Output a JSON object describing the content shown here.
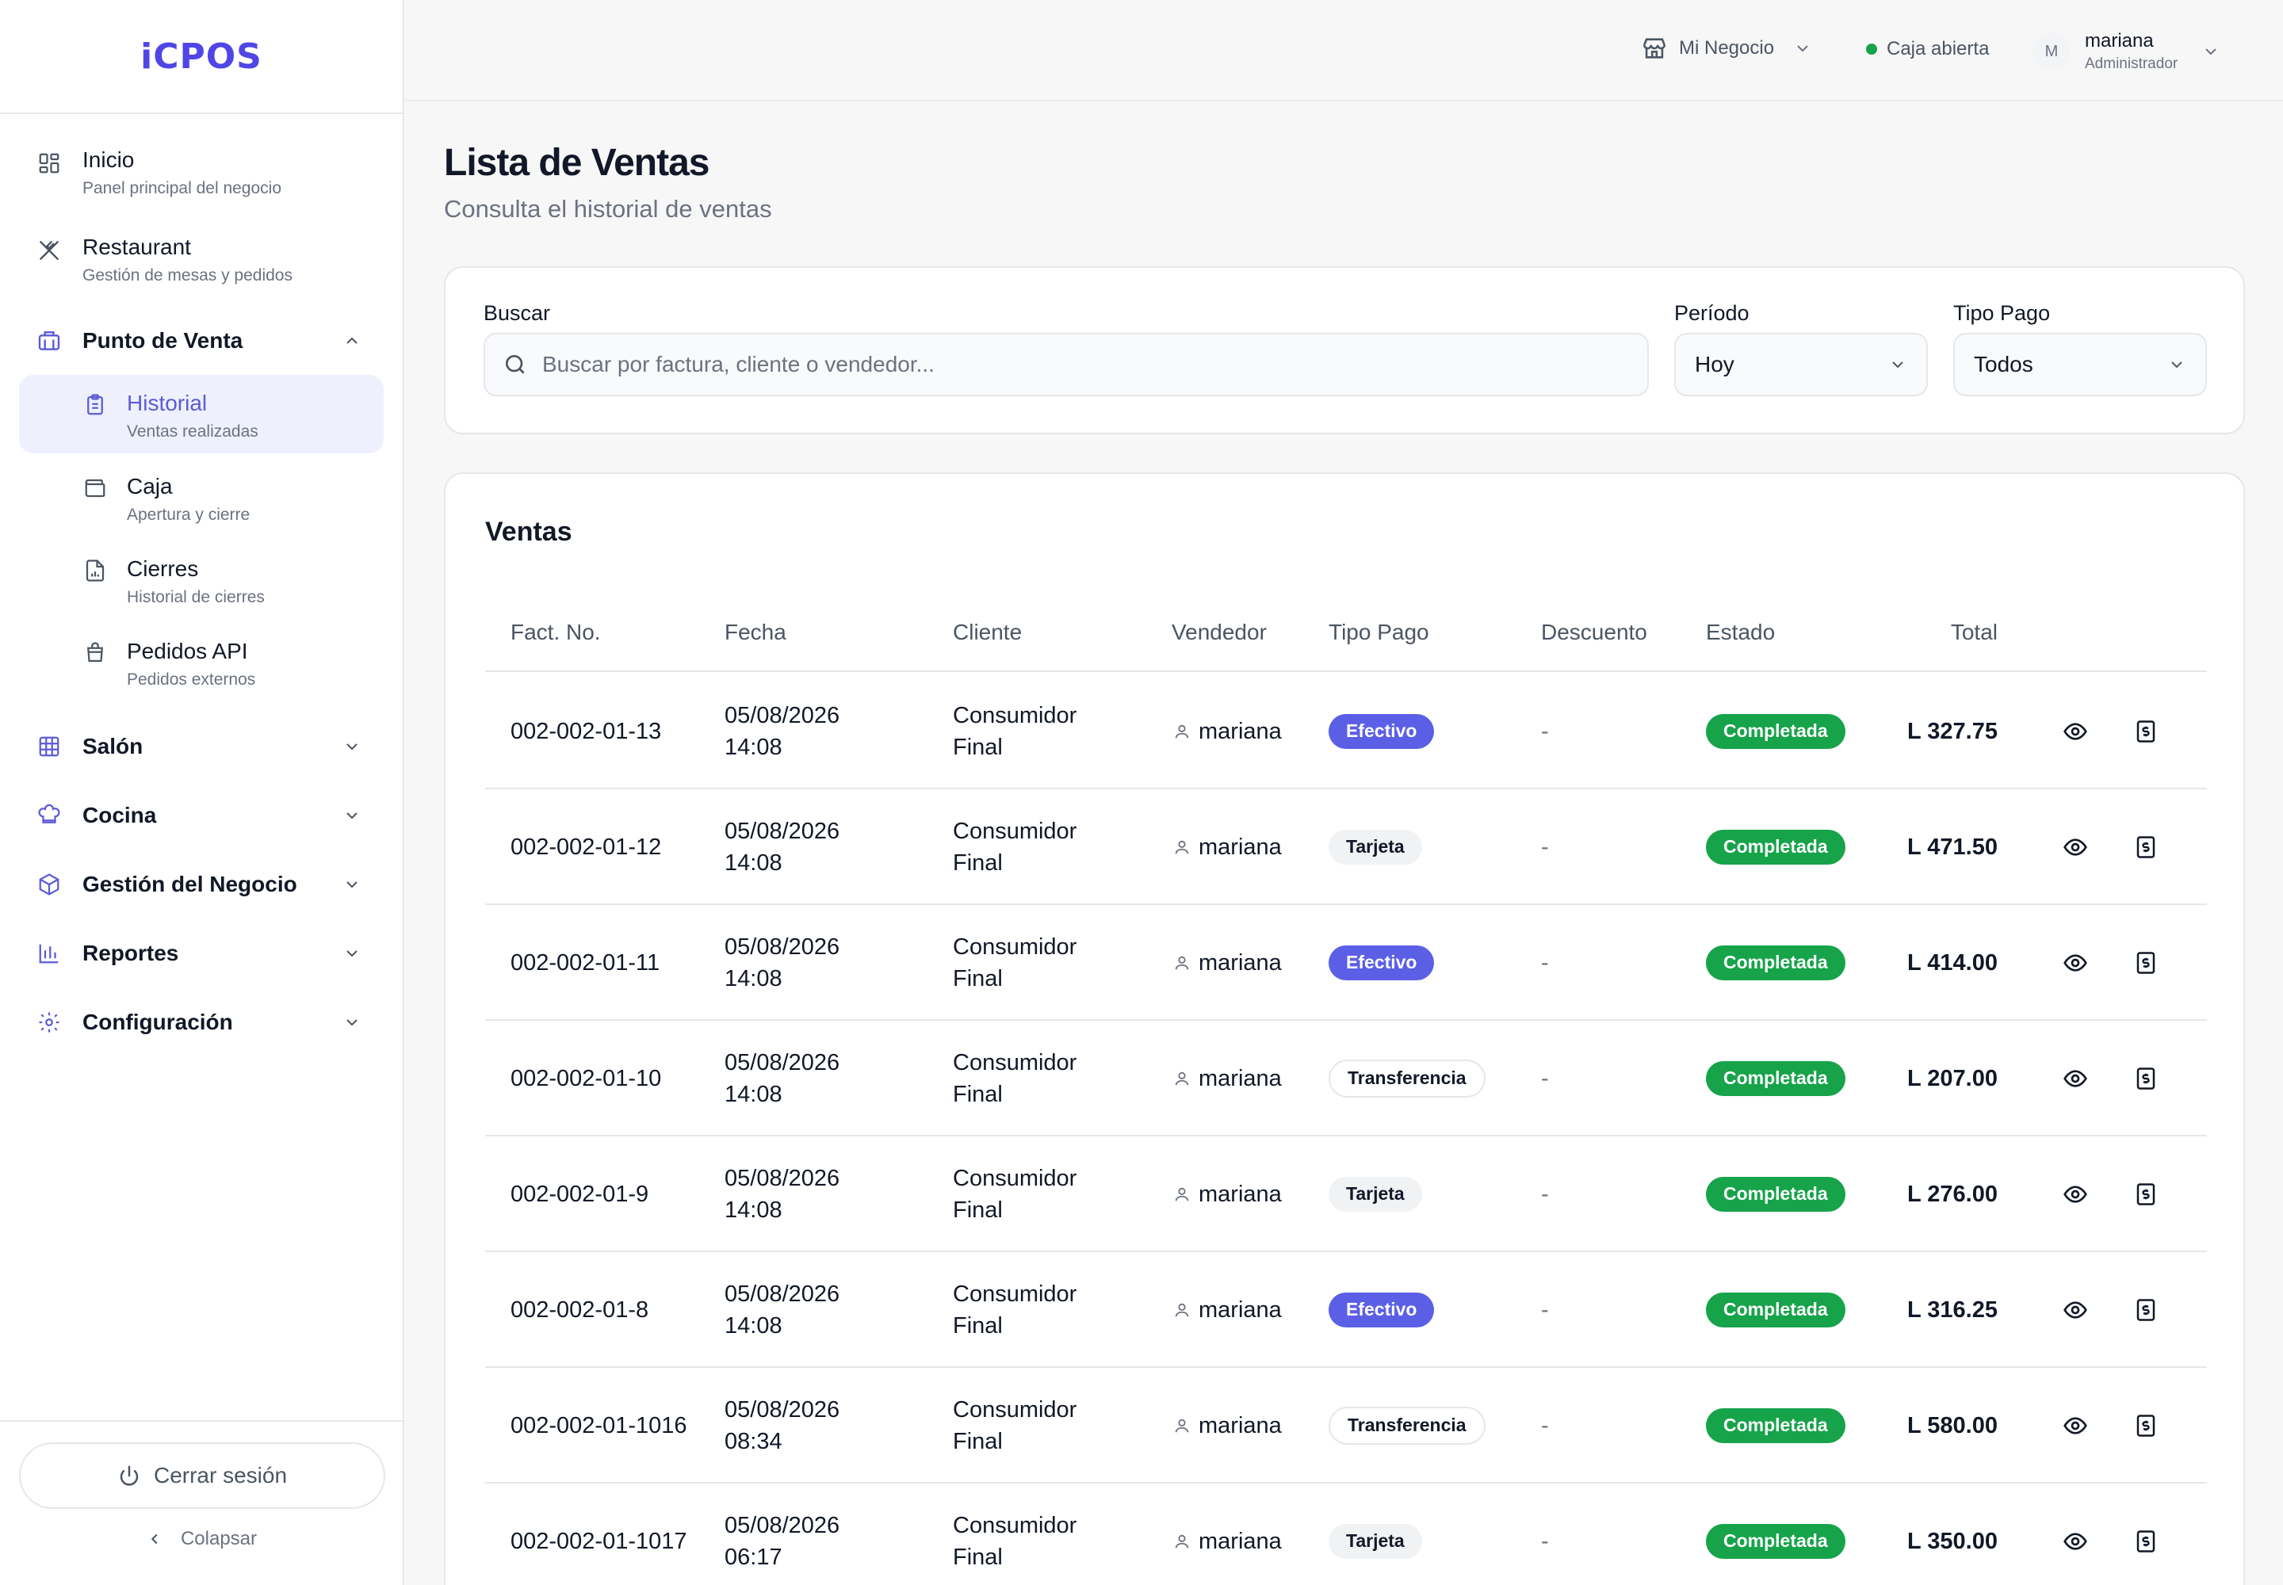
{
  "app": {
    "logo": "iCPOS"
  },
  "sidebar": {
    "inicio": {
      "label": "Inicio",
      "sub": "Panel principal del negocio"
    },
    "restaurant": {
      "label": "Restaurant",
      "sub": "Gestión de mesas y pedidos"
    },
    "punto_venta": {
      "label": "Punto de Venta"
    },
    "historial": {
      "label": "Historial",
      "sub": "Ventas realizadas"
    },
    "caja": {
      "label": "Caja",
      "sub": "Apertura y cierre"
    },
    "cierres": {
      "label": "Cierres",
      "sub": "Historial de cierres"
    },
    "pedidos_api": {
      "label": "Pedidos API",
      "sub": "Pedidos externos"
    },
    "salon": {
      "label": "Salón"
    },
    "cocina": {
      "label": "Cocina"
    },
    "gestion": {
      "label": "Gestión del Negocio"
    },
    "reportes": {
      "label": "Reportes"
    },
    "configuracion": {
      "label": "Configuración"
    },
    "logout": "Cerrar sesión",
    "collapse": "Colapsar"
  },
  "topbar": {
    "business": "Mi Negocio",
    "caja_status": "Caja abierta",
    "user_initial": "M",
    "user_name": "mariana",
    "user_role": "Administrador"
  },
  "page": {
    "title": "Lista de Ventas",
    "subtitle": "Consulta el historial de ventas"
  },
  "filters": {
    "search_label": "Buscar",
    "search_placeholder": "Buscar por factura, cliente o vendedor...",
    "period_label": "Período",
    "period_value": "Hoy",
    "payment_label": "Tipo Pago",
    "payment_value": "Todos"
  },
  "table": {
    "title": "Ventas",
    "headers": {
      "fact": "Fact. No.",
      "fecha": "Fecha",
      "cliente": "Cliente",
      "vendedor": "Vendedor",
      "tipo": "Tipo Pago",
      "descuento": "Descuento",
      "estado": "Estado",
      "total": "Total"
    },
    "rows": [
      {
        "fact": "002-002-01-13",
        "fecha": "05/08/2026 14:08",
        "cliente": "Consumidor Final",
        "vendedor": "mariana",
        "tipo": "Efectivo",
        "descuento": "-",
        "estado": "Completada",
        "total": "L 327.75"
      },
      {
        "fact": "002-002-01-12",
        "fecha": "05/08/2026 14:08",
        "cliente": "Consumidor Final",
        "vendedor": "mariana",
        "tipo": "Tarjeta",
        "descuento": "-",
        "estado": "Completada",
        "total": "L 471.50"
      },
      {
        "fact": "002-002-01-11",
        "fecha": "05/08/2026 14:08",
        "cliente": "Consumidor Final",
        "vendedor": "mariana",
        "tipo": "Efectivo",
        "descuento": "-",
        "estado": "Completada",
        "total": "L 414.00"
      },
      {
        "fact": "002-002-01-10",
        "fecha": "05/08/2026 14:08",
        "cliente": "Consumidor Final",
        "vendedor": "mariana",
        "tipo": "Transferencia",
        "descuento": "-",
        "estado": "Completada",
        "total": "L 207.00"
      },
      {
        "fact": "002-002-01-9",
        "fecha": "05/08/2026 14:08",
        "cliente": "Consumidor Final",
        "vendedor": "mariana",
        "tipo": "Tarjeta",
        "descuento": "-",
        "estado": "Completada",
        "total": "L 276.00"
      },
      {
        "fact": "002-002-01-8",
        "fecha": "05/08/2026 14:08",
        "cliente": "Consumidor Final",
        "vendedor": "mariana",
        "tipo": "Efectivo",
        "descuento": "-",
        "estado": "Completada",
        "total": "L 316.25"
      },
      {
        "fact": "002-002-01-1016",
        "fecha": "05/08/2026 08:34",
        "cliente": "Consumidor Final",
        "vendedor": "mariana",
        "tipo": "Transferencia",
        "descuento": "-",
        "estado": "Completada",
        "total": "L 580.00"
      },
      {
        "fact": "002-002-01-1017",
        "fecha": "05/08/2026 06:17",
        "cliente": "Consumidor Final",
        "vendedor": "mariana",
        "tipo": "Tarjeta",
        "descuento": "-",
        "estado": "Completada",
        "total": "L 350.00"
      }
    ]
  },
  "colors": {
    "accent": "#5b5fe6",
    "success": "#16a34a",
    "logo": "#4f46e5"
  },
  "icons": {
    "inicio": "grid-icon",
    "restaurant": "utensils-icon",
    "punto_venta": "store-icon",
    "historial": "clipboard-icon",
    "caja": "wallet-icon",
    "cierres": "file-chart-icon",
    "pedidos_api": "shopping-bag-icon",
    "salon": "table-grid-icon",
    "cocina": "chef-hat-icon",
    "gestion": "package-icon",
    "reportes": "bar-chart-icon",
    "configuracion": "gear-icon",
    "row_view": "eye-icon",
    "row_invoice": "receipt-icon"
  }
}
